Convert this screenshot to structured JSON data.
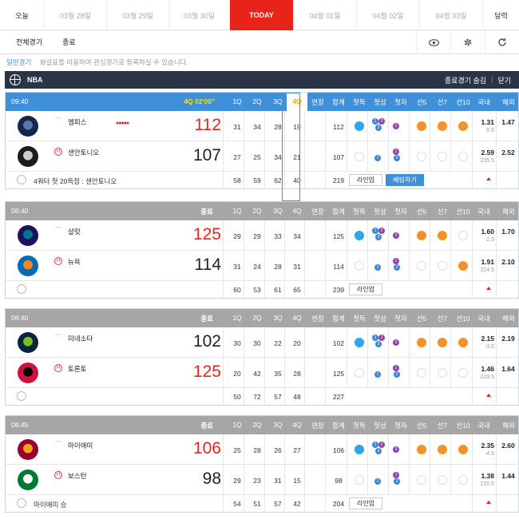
{
  "dates": [
    "오늘",
    "03월 28일",
    "03월 29일",
    "03월 30일",
    "TODAY",
    "04월 01일",
    "04월 02일",
    "04월 03일",
    "달력"
  ],
  "filters": [
    "전체경기",
    "종료"
  ],
  "icons": [
    "eye-icon",
    "gear-icon",
    "refresh-icon"
  ],
  "notice": {
    "tag": "일반경기",
    "text": "화살표를 이용하여 관심경기로 등록하실 수 있습니다."
  },
  "league": {
    "name": "NBA",
    "hide_finished": "종료경기 숨김",
    "sep": "|",
    "close": "닫기"
  },
  "columns": [
    "1Q",
    "2Q",
    "3Q",
    "4Q",
    "연장",
    "합계",
    "첫득",
    "첫삼",
    "첫자",
    "선5",
    "선7",
    "선10",
    "국내",
    "해외"
  ],
  "games": [
    {
      "time": "09:40",
      "status": "4Q 02'00\"",
      "live": true,
      "teams": [
        {
          "name": "멤피스",
          "home": false,
          "dots": "●●●●●",
          "score": "112",
          "win": true,
          "q": [
            "31",
            "34",
            "28",
            "19"
          ],
          "ot": "",
          "total": "112",
          "first_score": "blue",
          "s5": "orange",
          "s7": "orange",
          "s10": "orange",
          "odds": "1.31",
          "odds_sub": "5.5",
          "odds2": "1.47"
        },
        {
          "name": "샌안토니오",
          "home": true,
          "dots": "",
          "score": "107",
          "win": false,
          "q": [
            "27",
            "25",
            "34",
            "21"
          ],
          "ot": "",
          "total": "107",
          "first_score": "empty",
          "s5": "empty",
          "s7": "empty",
          "s10": "empty",
          "odds": "2.59",
          "odds_sub": "235.5",
          "odds2": "2.52"
        }
      ],
      "totals": [
        "58",
        "59",
        "62",
        "40",
        "",
        "219"
      ],
      "note": "4쿼터 첫 20득점 : 샌안토니오",
      "buttons": [
        "라인업",
        "베팅하기"
      ]
    },
    {
      "time": "08:40",
      "status": "종료",
      "live": false,
      "teams": [
        {
          "name": "샬럿",
          "home": false,
          "dots": "",
          "score": "125",
          "win": true,
          "q": [
            "29",
            "29",
            "33",
            "34"
          ],
          "ot": "",
          "total": "125",
          "first_score": "blue",
          "s5": "orange",
          "s7": "orange",
          "s10": "empty",
          "odds": "1.60",
          "odds_sub": "2.5",
          "odds2": "1.70"
        },
        {
          "name": "뉴욕",
          "home": true,
          "dots": "",
          "score": "114",
          "win": false,
          "q": [
            "31",
            "24",
            "28",
            "31"
          ],
          "ot": "",
          "total": "114",
          "first_score": "empty",
          "s5": "empty",
          "s7": "empty",
          "s10": "orange",
          "odds": "1.91",
          "odds_sub": "224.5",
          "odds2": "2.10"
        }
      ],
      "totals": [
        "60",
        "53",
        "61",
        "65",
        "",
        "239"
      ],
      "note": "",
      "buttons": [
        "라인업"
      ]
    },
    {
      "time": "08:40",
      "status": "종료",
      "live": false,
      "teams": [
        {
          "name": "미네소타",
          "home": false,
          "dots": "",
          "score": "102",
          "win": false,
          "q": [
            "30",
            "30",
            "22",
            "20"
          ],
          "ot": "",
          "total": "102",
          "first_score": "blue",
          "s5": "orange",
          "s7": "orange",
          "s10": "orange",
          "odds": "2.15",
          "odds_sub": "-3.5",
          "odds2": "2.19"
        },
        {
          "name": "토론토",
          "home": true,
          "dots": "",
          "score": "125",
          "win": true,
          "q": [
            "20",
            "42",
            "35",
            "28"
          ],
          "ot": "",
          "total": "125",
          "first_score": "empty",
          "s5": "empty",
          "s7": "empty",
          "s10": "empty",
          "odds": "1.46",
          "odds_sub": "229.5",
          "odds2": "1.64"
        }
      ],
      "totals": [
        "50",
        "72",
        "57",
        "48",
        "",
        "227"
      ],
      "note": "",
      "buttons": []
    },
    {
      "time": "08:45",
      "status": "종료",
      "live": false,
      "teams": [
        {
          "name": "마이애미",
          "home": false,
          "dots": "",
          "score": "106",
          "win": true,
          "q": [
            "25",
            "28",
            "26",
            "27"
          ],
          "ot": "",
          "total": "106",
          "first_score": "blue",
          "s5": "orange",
          "s7": "orange",
          "s10": "orange",
          "odds": "2.35",
          "odds_sub": "-4.5",
          "odds2": "2.60"
        },
        {
          "name": "보스턴",
          "home": true,
          "dots": "",
          "score": "98",
          "win": false,
          "q": [
            "29",
            "23",
            "31",
            "15"
          ],
          "ot": "",
          "total": "98",
          "first_score": "empty",
          "s5": "empty",
          "s7": "empty",
          "s10": "empty",
          "odds": "1.38",
          "odds_sub": "215.5",
          "odds2": "1.44"
        }
      ],
      "totals": [
        "54",
        "51",
        "57",
        "42",
        "",
        "204"
      ],
      "note": "마이애미 승",
      "buttons": [
        "라인업"
      ]
    }
  ],
  "colors": {
    "live": "#3f8fd9",
    "done": "#a6a6a6",
    "today": "#e8231a",
    "win": "#e8231a",
    "first": "#2aa7e6",
    "lead": "#f2922a"
  }
}
